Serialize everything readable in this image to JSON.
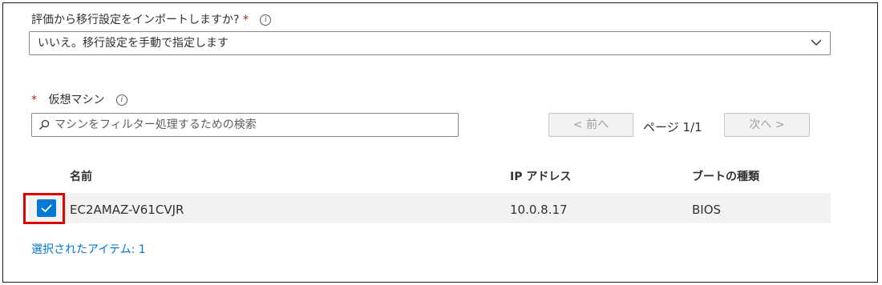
{
  "import": {
    "label": "評価から移行設定をインポートしますか?",
    "required_mark": "*",
    "info": "i",
    "selected": "いいえ。移行設定を手動で指定します"
  },
  "vm": {
    "required_mark": "*",
    "label": "仮想マシン",
    "info": "i",
    "search_placeholder": "マシンをフィルター処理するための検索"
  },
  "pager": {
    "prev": "< 前へ",
    "page_text": "ページ 1/1",
    "next": "次へ >"
  },
  "table": {
    "headers": [
      "名前",
      "IP アドレス",
      "ブートの種類"
    ],
    "rows": [
      {
        "name": "EC2AMAZ-V61CVJR",
        "ip": "10.0.8.17",
        "boot": "BIOS",
        "checked": true
      }
    ]
  },
  "selection": {
    "summary": "選択されたアイテム: 1"
  },
  "colors": {
    "accent": "#0078d4",
    "highlight": "#e00000",
    "required": "#a4262c"
  }
}
